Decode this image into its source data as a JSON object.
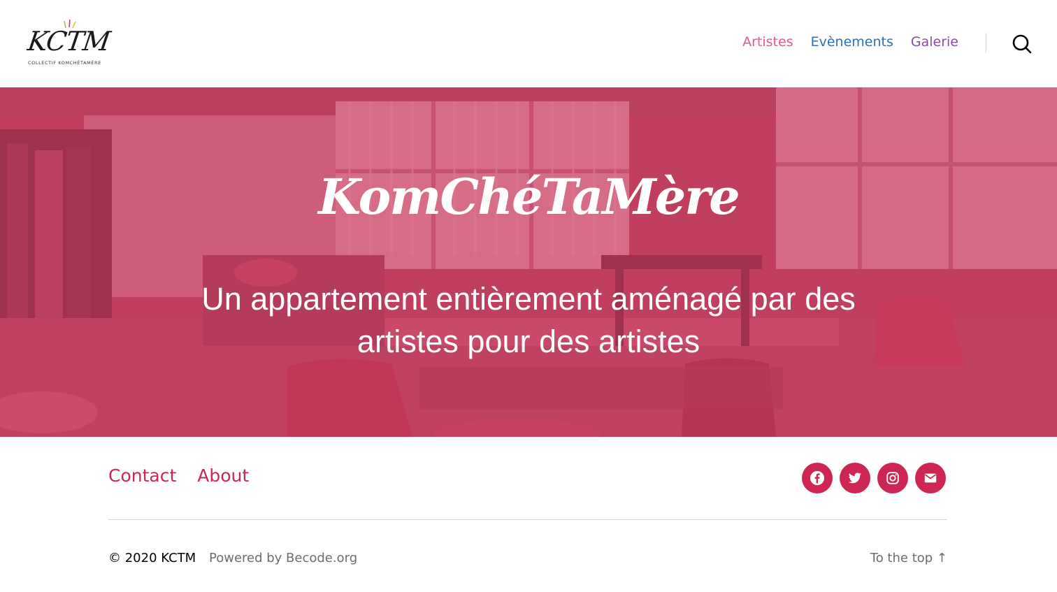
{
  "header": {
    "logo_mark": "KCTM",
    "logo_subtitle": "COLLECTIF KOMCHÉTAMÈRE",
    "nav": [
      {
        "label": "Artistes",
        "color": "#e05a8a"
      },
      {
        "label": "Evènements",
        "color": "#2d6fb8"
      },
      {
        "label": "Galerie",
        "color": "#8b4aa8"
      }
    ],
    "search_icon": "search-icon"
  },
  "hero": {
    "title": "KomChéTaMère",
    "subtitle": "Un appartement entièrement aménagé par des artistes pour des artistes",
    "overlay_color": "#cd3c5f"
  },
  "footer": {
    "menu": [
      "Contact",
      "About"
    ],
    "social": [
      {
        "name": "facebook-icon"
      },
      {
        "name": "twitter-icon"
      },
      {
        "name": "instagram-icon"
      },
      {
        "name": "email-icon"
      }
    ],
    "social_color": "#cd2653",
    "copyright": "© 2020 KCTM",
    "powered_by": "Powered by Becode.org",
    "to_top": "To the top ↑"
  }
}
